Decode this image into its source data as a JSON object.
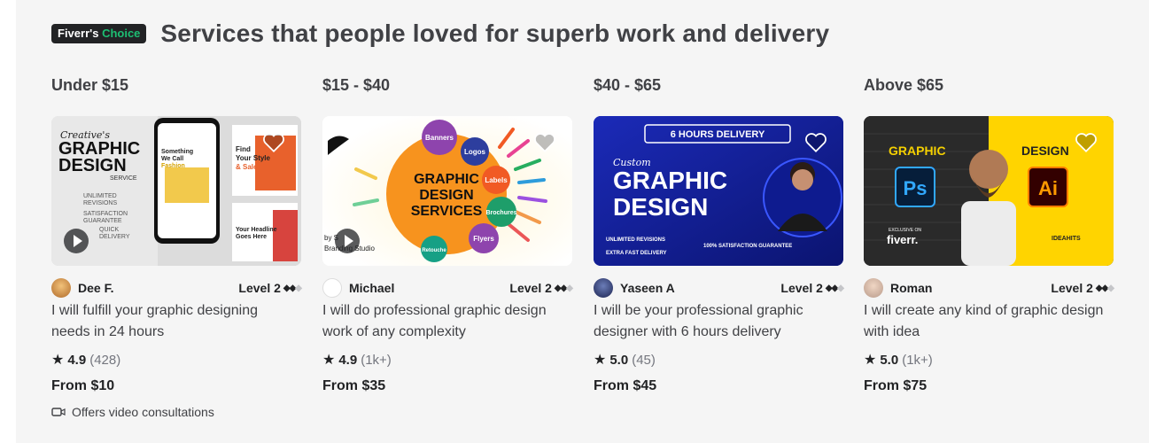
{
  "header": {
    "badge_brand": "Fiverr's",
    "badge_accent": " Choice",
    "title": "Services that people loved for superb work and delivery"
  },
  "columns": [
    {
      "range": "Under $15",
      "seller": "Dee F.",
      "level": "Level 2",
      "title": "I will fulfill your graphic designing needs in 24 hours",
      "score": "4.9",
      "count": "(428)",
      "price": "From $10",
      "video_note": "Offers video consultations",
      "thumb_text": {
        "l1": "Creative's",
        "l2": "GRAPHIC",
        "l3": "DESIGN",
        "l4": "SERVICE",
        "f1": "UNLIMITED",
        "f2": "REVISIONS",
        "f3": "SATISFACTION",
        "f4": "GUARANTEE",
        "f5": "QUICK",
        "f6": "DELIVERY",
        "phone1": "Something",
        "phone2": "We Call",
        "phone3": "Fashion",
        "card1": "Find",
        "card2": "Your Style",
        "card3": "& Sale",
        "card4": "Your Headline",
        "card5": "Goes Here"
      }
    },
    {
      "range": "$15 - $40",
      "seller": "Michael",
      "level": "Level 2",
      "title": "I will do professional graphic design work of any complexity",
      "score": "4.9",
      "count": "(1k+)",
      "price": "From $35",
      "thumb_text": {
        "main1": "GRAPHIC",
        "main2": "DESIGN",
        "main3": "SERVICES",
        "b1": "Banners",
        "b2": "Logos",
        "b3": "Labels",
        "b4": "Brochures",
        "b5": "Flyers",
        "b6": "Retouche",
        "studio1": "by S",
        "studio2": "Branding Studio"
      }
    },
    {
      "range": "$40 - $65",
      "seller": "Yaseen A",
      "level": "Level 2",
      "title": "I will be your professional graphic designer with 6 hours delivery",
      "score": "5.0",
      "count": "(45)",
      "price": "From $45",
      "thumb_text": {
        "banner": "6 HOURS DELIVERY",
        "custom": "Custom",
        "l1": "GRAPHIC",
        "l2": "DESIGN",
        "c1": "UNLIMITED REVISIONS",
        "c2": "EXTRA FAST DELIVERY",
        "c3": "100% SATISFACTION GUARANTEE"
      }
    },
    {
      "range": "Above $65",
      "seller": "Roman",
      "level": "Level 2",
      "title": "I will create any kind of graphic design with idea",
      "score": "5.0",
      "count": "(1k+)",
      "price": "From $75",
      "thumb_text": {
        "left": "GRAPHIC",
        "right": "DESIGN",
        "ps": "Ps",
        "ai": "Ai",
        "exclusive": "EXCLUSIVE ON",
        "fiverr": "fiverr.",
        "brand": "IDEAHITS"
      }
    }
  ],
  "colors": {
    "accent_green": "#1dbf73",
    "badge_dark": "#222325",
    "panel_bg": "#f5f5f5"
  }
}
